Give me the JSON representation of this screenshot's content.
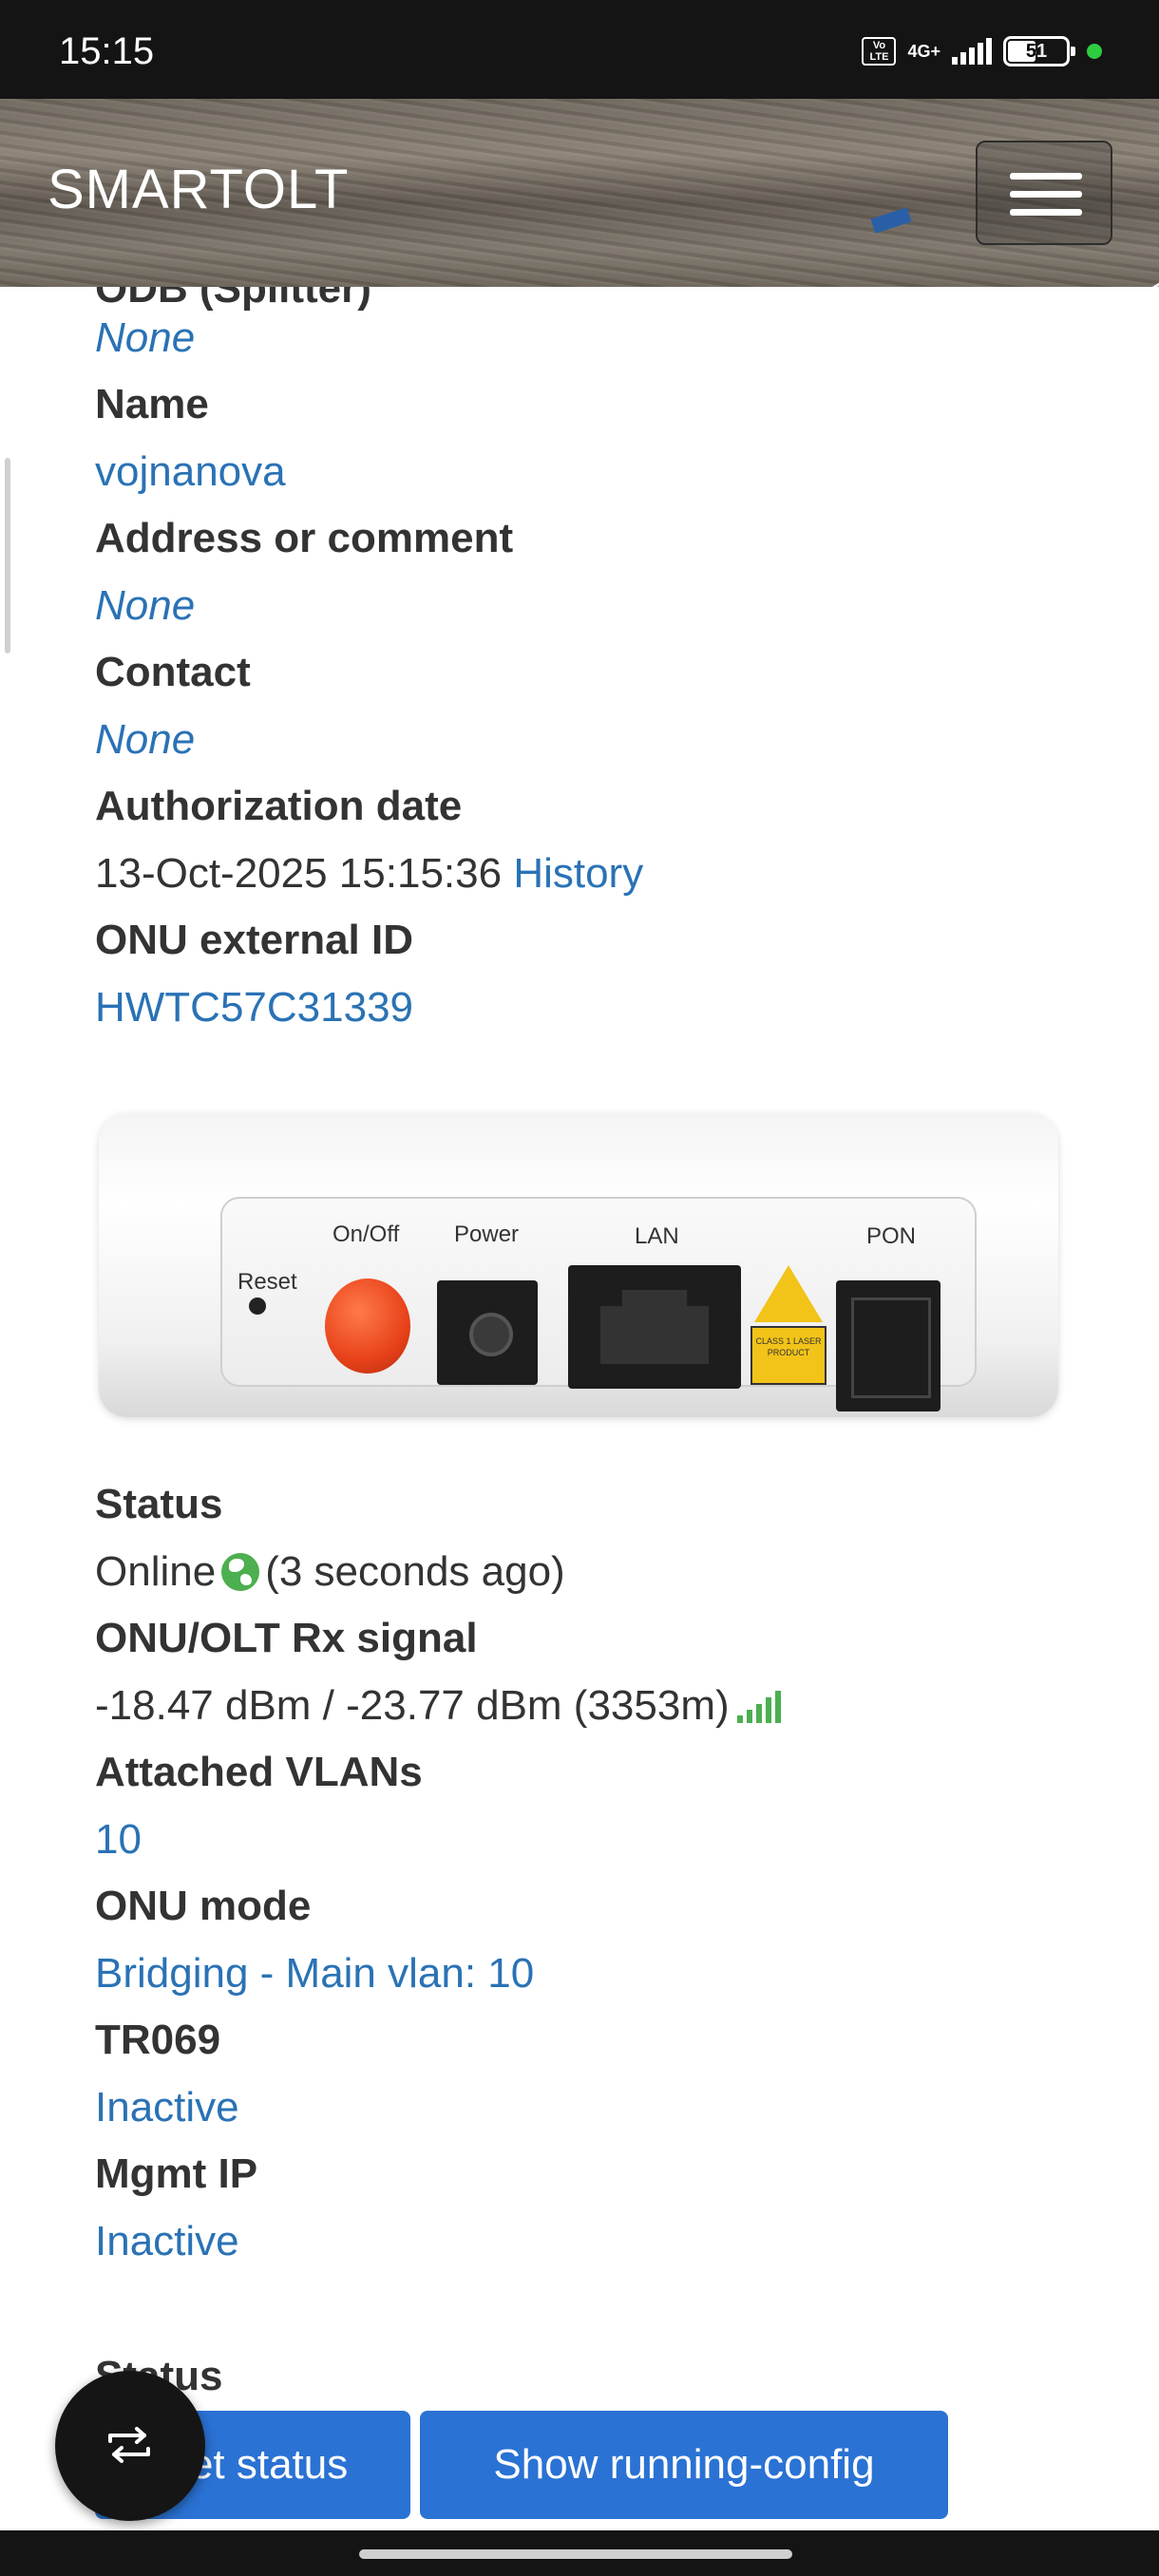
{
  "status_bar": {
    "time": "15:15",
    "volte": "Vo LTE",
    "network": "4G+",
    "battery": "51",
    "battery_level": 0.51
  },
  "navbar": {
    "brand": "SMARTOLT",
    "menu_icon": "hamburger-icon"
  },
  "details": {
    "odb_label": "ODB (Splitter)",
    "odb_value": "None",
    "name_label": "Name",
    "name_value": "vojnanova",
    "address_label": "Address or comment",
    "address_value": "None",
    "contact_label": "Contact",
    "contact_value": "None",
    "auth_label": "Authorization date",
    "auth_value": "13-Oct-2025 15:15:36",
    "auth_history": "History",
    "ext_id_label": "ONU external ID",
    "ext_id_value": "HWTC57C31339"
  },
  "device_image": {
    "reset": "Reset",
    "onoff": "On/Off",
    "power": "Power",
    "lan": "LAN",
    "pon": "PON",
    "laser": "CLASS 1 LASER PRODUCT"
  },
  "status_info": {
    "status_label": "Status",
    "status_value": "Online",
    "status_ago": "(3 seconds ago)",
    "status_icon": "globe-icon",
    "signal_label": "ONU/OLT Rx signal",
    "signal_value": "-18.47 dBm / -23.77 dBm (3353m)",
    "signal_icon": "signal-bars-icon",
    "vlans_label": "Attached VLANs",
    "vlans_value": "10",
    "mode_label": "ONU mode",
    "mode_value": "Bridging - Main vlan: 10",
    "tr069_label": "TR069",
    "tr069_value": "Inactive",
    "mgmt_label": "Mgmt IP",
    "mgmt_value": "Inactive",
    "section_label": "Status"
  },
  "actions": {
    "get_status": "Get status",
    "show_config": "Show running-config",
    "fab_icon": "swap-icon"
  },
  "colors": {
    "link": "#2a72b5",
    "button": "#2a72d4",
    "online": "#4caf50"
  }
}
